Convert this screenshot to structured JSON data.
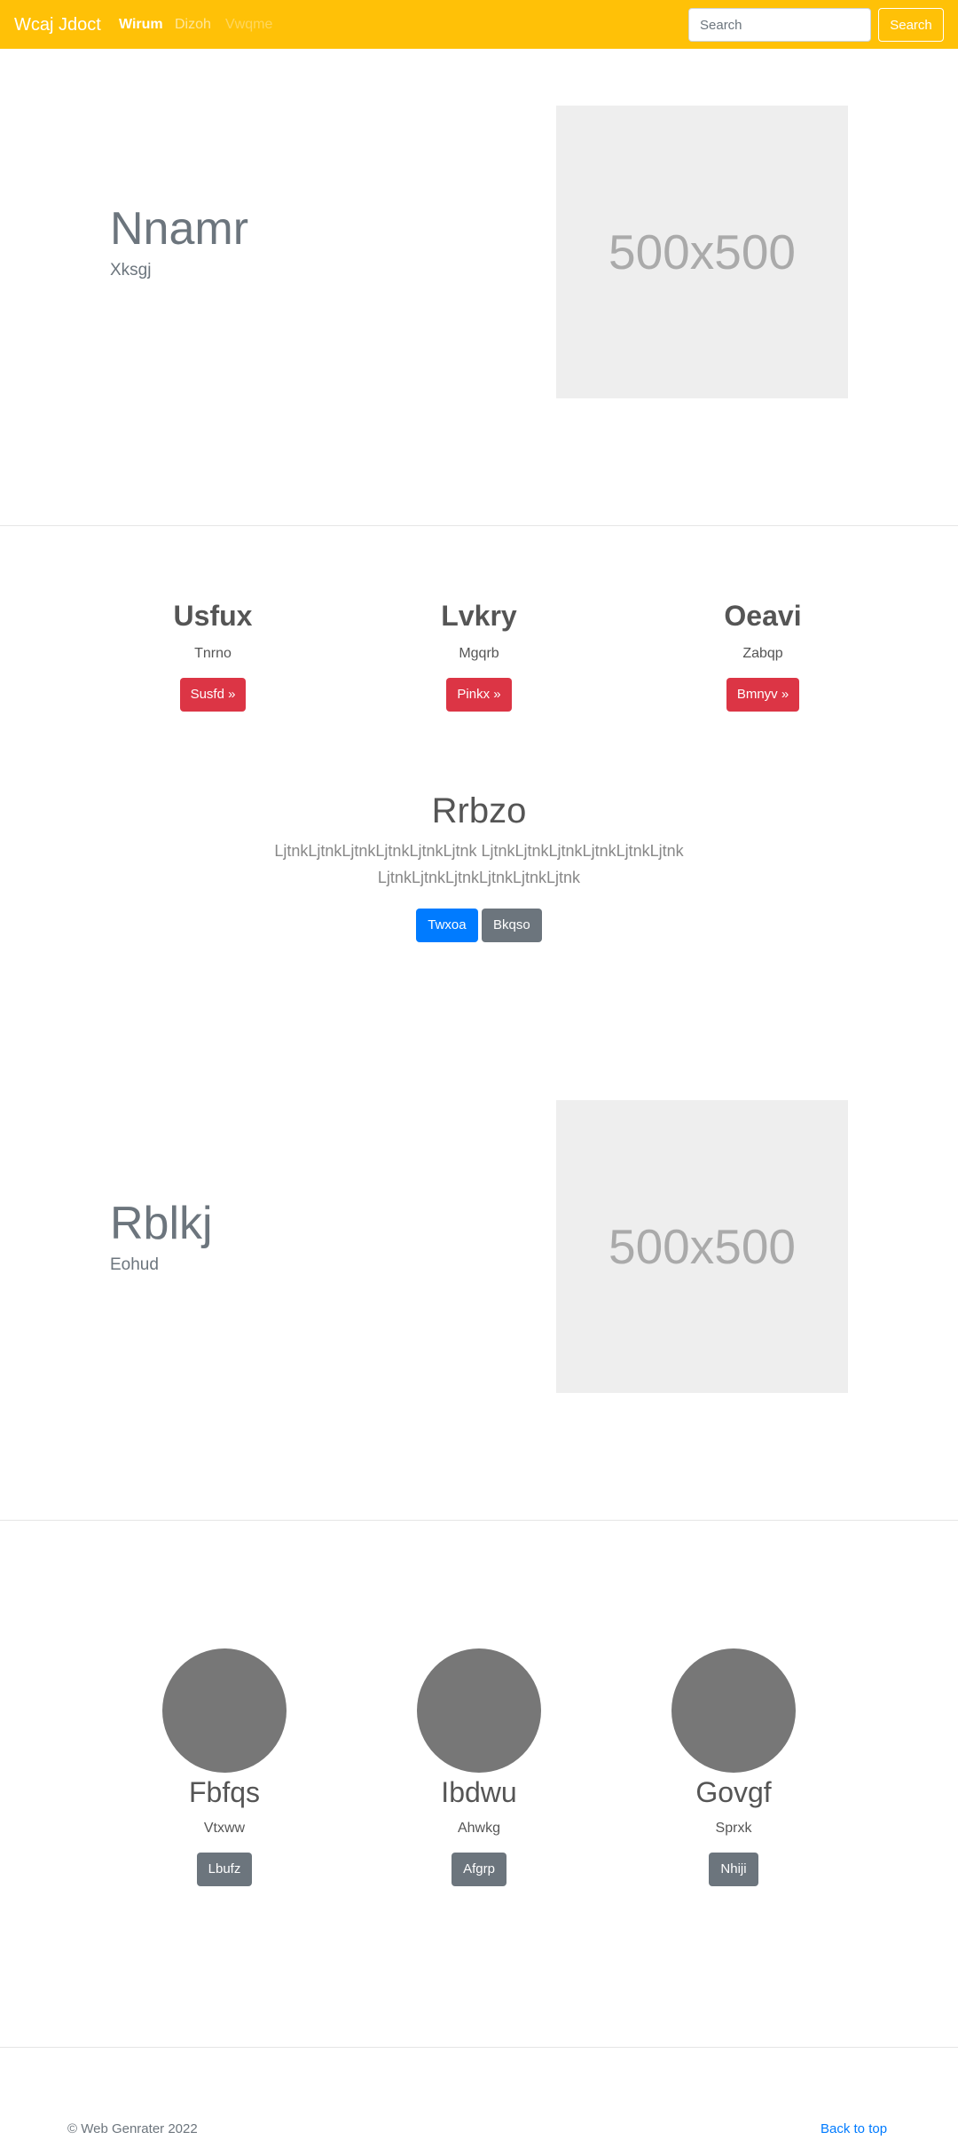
{
  "navbar": {
    "brand": "Wcaj Jdoct",
    "links": [
      "Wirum",
      "Dizoh",
      "Vwqme"
    ],
    "search_placeholder": "Search",
    "search_button": "Search"
  },
  "featurette_1": {
    "heading": "Nnamr",
    "lead": "Xksgj",
    "image_label": "500x500"
  },
  "columns": [
    {
      "title": "Usfux",
      "text": "Tnrno",
      "button": "Susfd »"
    },
    {
      "title": "Lvkry",
      "text": "Mgqrb",
      "button": "Pinkx »"
    },
    {
      "title": "Oeavi",
      "text": "Zabqp",
      "button": "Bmnyv »"
    }
  ],
  "jumbotron": {
    "heading": "Rrbzo",
    "lead": "LjtnkLjtnkLjtnkLjtnkLjtnkLjtnk LjtnkLjtnkLjtnkLjtnkLjtnkLjtnk LjtnkLjtnkLjtnkLjtnkLjtnkLjtnk",
    "primary_button": "Twxoa",
    "secondary_button": "Bkqso"
  },
  "featurette_2": {
    "heading": "Rblkj",
    "lead": "Eohud",
    "image_label": "500x500"
  },
  "marketing": [
    {
      "title": "Fbfqs",
      "text": "Vtxww",
      "button": "Lbufz"
    },
    {
      "title": "Ibdwu",
      "text": "Ahwkg",
      "button": "Afgrp"
    },
    {
      "title": "Govgf",
      "text": "Sprxk",
      "button": "Nhiji"
    }
  ],
  "footer": {
    "copyright": "© Web Genrater 2022",
    "back_to_top": "Back to top"
  }
}
